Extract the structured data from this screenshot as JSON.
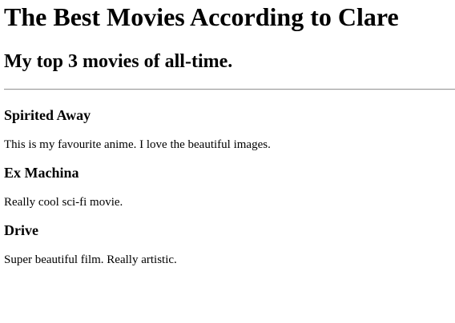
{
  "page": {
    "title": "The Best Movies According to Clare",
    "subtitle": "My top 3 movies of all-time."
  },
  "movies": [
    {
      "title": "Spirited Away",
      "description": "This is my favourite anime. I love the beautiful images."
    },
    {
      "title": "Ex Machina",
      "description": "Really cool sci-fi movie."
    },
    {
      "title": "Drive",
      "description": "Super beautiful film. Really artistic."
    }
  ]
}
